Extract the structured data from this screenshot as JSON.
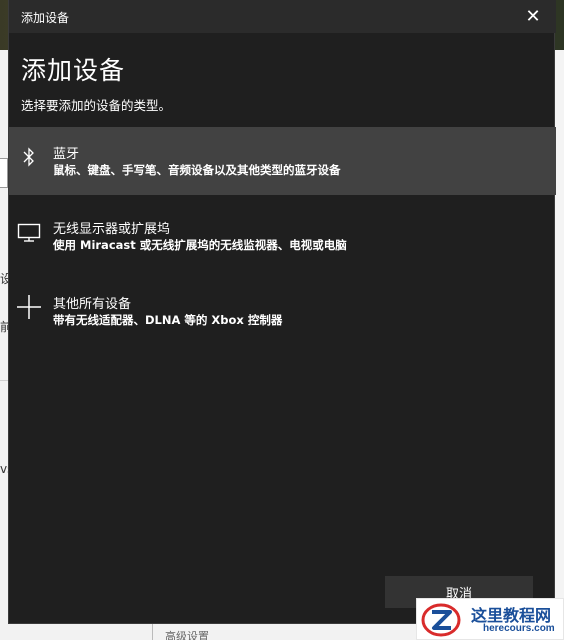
{
  "dialog": {
    "window_title": "添加设备",
    "close_glyph": "✕",
    "heading": "添加设备",
    "subtitle": "选择要添加的设备的类型。",
    "options": [
      {
        "icon": "bluetooth-icon",
        "name": "蓝牙",
        "description": "鼠标、键盘、手写笔、音频设备以及其他类型的蓝牙设备",
        "selected": true
      },
      {
        "icon": "monitor-icon",
        "name": "无线显示器或扩展坞",
        "description": "使用 Miracast 或无线扩展坞的无线监视器、电视或电脑",
        "selected": false
      },
      {
        "icon": "plus-icon",
        "name": "其他所有设备",
        "description": "带有无线适配器、DLNA 等的 Xbox 控制器",
        "selected": false
      }
    ],
    "cancel_label": "取消"
  },
  "background": {
    "left_fragments": [
      "设",
      "前",
      "vs"
    ],
    "bottom_fragment": "高级设置"
  },
  "watermark": {
    "site_name": "这里教程网",
    "url": "herecours.com"
  },
  "colors": {
    "dialog_bg": "#1f1f1f",
    "titlebar_bg": "#2b2b2b",
    "selected_bg": "#424242",
    "button_bg": "#333333",
    "text": "#ffffff",
    "watermark_blue": "#1a4f9a",
    "watermark_red": "#d92b2b"
  }
}
